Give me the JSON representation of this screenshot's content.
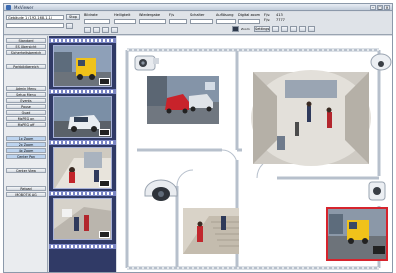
{
  "window": {
    "title": "MxViewer"
  },
  "toolbar": {
    "camera_field": "Gebäude 1 (192.168.1.1)",
    "stop_button": "Stop",
    "labels": [
      "Bildrate",
      "Helligkeit",
      "Wiedergabe",
      "F/s",
      "Schalter",
      "Auflösung",
      "Digital zoom",
      "F/s:",
      "413",
      "F/s:",
      "7777"
    ],
    "zoom_label": "Zoom",
    "settings_button": "Settings"
  },
  "left_menu": {
    "items": [
      "Standard",
      "ES Übersicht",
      "Sicherheitsbereich",
      "Parkbildbereich",
      "Admin Menu",
      "Setup Menu",
      "Events",
      "Pause",
      "Quad",
      "MxPEG on",
      "MxPEG off",
      "1x Zoom",
      "2x Zoom",
      "4x Zoom",
      "Center Pan",
      "Center View",
      "Reload",
      "MOBOTIX AG"
    ]
  },
  "colors": {
    "strip_bg": "#303a66",
    "film_bar": "#7b86c5",
    "highlight_border": "#d6242d",
    "floorplan_wall": "#b7c0cc"
  },
  "icons": [
    "camera-icon",
    "dome-camera-icon",
    "ceiling-camera-icon",
    "wall-camera-icon"
  ]
}
